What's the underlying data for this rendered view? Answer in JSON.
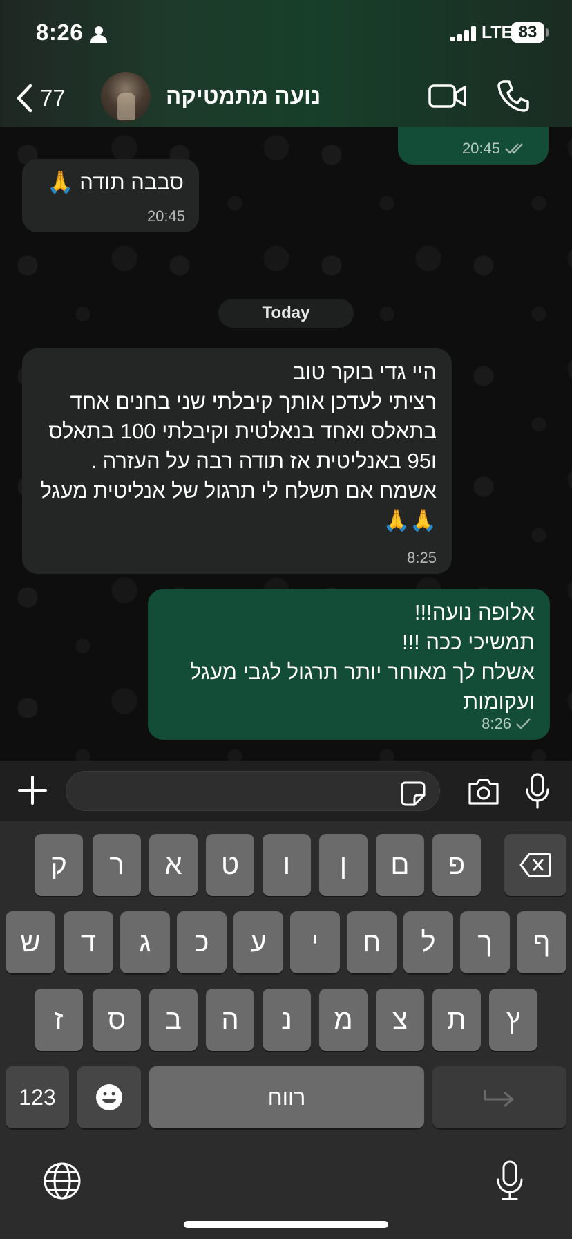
{
  "status_bar": {
    "time": "8:26",
    "network": "LTE",
    "battery": "83"
  },
  "header": {
    "back_count": "77",
    "contact_name": "נועה מתמטיקה"
  },
  "chat": {
    "messages": [
      {
        "direction": "out",
        "text": "",
        "time": "20:45",
        "status": "read"
      },
      {
        "direction": "in",
        "text": "סבבה תודה 🙏",
        "time": "20:45"
      },
      {
        "direction": "in",
        "text": "היי גדי  בוקר טוב\nרציתי לעדכן אותך קיבלתי שני בחנים אחד בתאלס ואחד בנאלטית וקיבלתי 100 בתאלס ו95 באנליטית אז תודה רבה על העזרה . אשמח אם תשלח לי תרגול של אנליטית מעגל 🙏🙏",
        "time": "8:25"
      },
      {
        "direction": "out",
        "text": "אלופה נועה!!!\nתמשיכי ככה !!!\nאשלח לך מאוחר יותר תרגול לגבי מעגל ועקומות",
        "time": "8:26",
        "status": "sent"
      }
    ],
    "date_separator": "Today"
  },
  "keyboard": {
    "row1": [
      "ק",
      "ר",
      "א",
      "ט",
      "ו",
      "ן",
      "ם",
      "פ"
    ],
    "row2": [
      "ש",
      "ד",
      "ג",
      "כ",
      "ע",
      "י",
      "ח",
      "ל",
      "ך",
      "ף"
    ],
    "row3": [
      "ז",
      "ס",
      "ב",
      "ה",
      "נ",
      "מ",
      "צ",
      "ת",
      "ץ"
    ],
    "numbers_label": "123",
    "space_label": "רווח"
  },
  "colors": {
    "outgoing_bubble": "#134d37",
    "incoming_bubble": "#242626",
    "accent": "#25d366"
  }
}
